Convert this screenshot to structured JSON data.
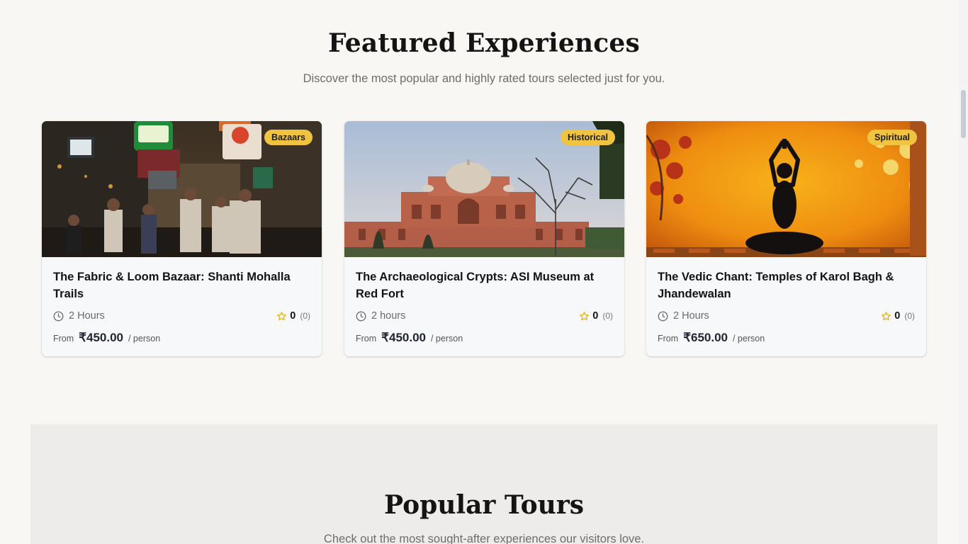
{
  "featured": {
    "title": "Featured Experiences",
    "subtitle": "Discover the most popular and highly rated tours selected just for you."
  },
  "cards": [
    {
      "badge": "Bazaars",
      "title": "The Fabric & Loom Bazaar: Shanti Mohalla Trails",
      "duration": "2 Hours",
      "rating": "0",
      "rating_count": "(0)",
      "from_label": "From",
      "price": "₹450.00",
      "per_label": "/ person",
      "image": "bazaar-street-photo"
    },
    {
      "badge": "Historical",
      "title": "The Archaeological Crypts: ASI Museum at Red Fort",
      "duration": "2 hours",
      "rating": "0",
      "rating_count": "(0)",
      "from_label": "From",
      "price": "₹450.00",
      "per_label": "/ person",
      "image": "humayun-tomb-photo"
    },
    {
      "badge": "Spiritual",
      "title": "The Vedic Chant: Temples of Karol Bagh & Jhandewalan",
      "duration": "2 Hours",
      "rating": "0",
      "rating_count": "(0)",
      "from_label": "From",
      "price": "₹650.00",
      "per_label": "/ person",
      "image": "meditation-statue-photo"
    }
  ],
  "popular": {
    "title": "Popular Tours",
    "subtitle": "Check out the most sought-after experiences our visitors love."
  },
  "colors": {
    "badge": "#f0c341",
    "star": "#e3b116",
    "background": "#f8f7f4",
    "band": "#edecea"
  },
  "icons": {
    "duration": "clock-icon",
    "rating": "star-icon"
  }
}
